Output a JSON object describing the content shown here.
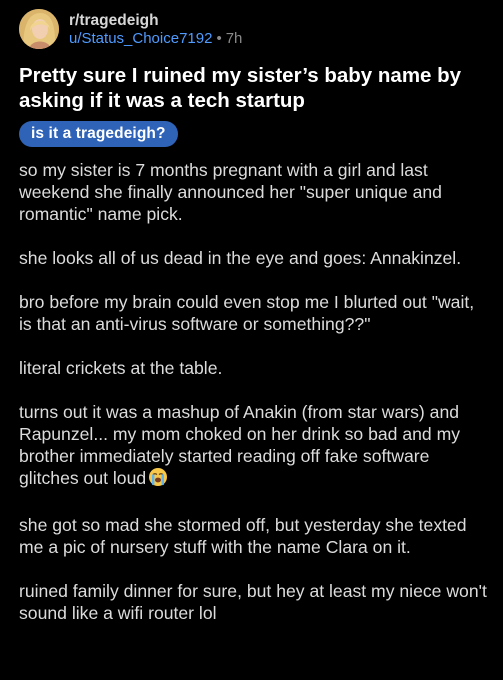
{
  "post": {
    "subreddit": "r/tragedeigh",
    "username": "u/Status_Choice7192",
    "separator": "•",
    "age": "7h",
    "title": "Pretty sure I ruined my sister’s baby name by asking if it was a tech startup",
    "flair": "is it a tragedeigh?",
    "paragraphs": [
      "so my sister is 7 months pregnant with a girl and last weekend she finally announced her \"super unique and romantic\" name pick.",
      "she looks all of us dead in the eye and goes: Annakinzel.",
      "bro before my brain could even stop me I blurted out \"wait, is that an anti-virus software or something??\"",
      "literal crickets at the table.",
      "turns out it was a mashup of Anakin (from star wars) and Rapunzel... my mom choked on her drink so bad and my brother immediately started reading off fake software glitches out loud",
      "she got so mad she stormed off, but yesterday she texted me a pic of nursery stuff with the name Clara on it.",
      "ruined family dinner for sure, but hey at least my niece won't sound like a wifi router lol"
    ],
    "emoji_icon": "loudly-crying-face-icon"
  },
  "colors": {
    "background": "#000000",
    "username": "#4f9bff",
    "flair_background": "#2f63b8",
    "title": "#ffffff",
    "body": "#dcdcdc"
  }
}
